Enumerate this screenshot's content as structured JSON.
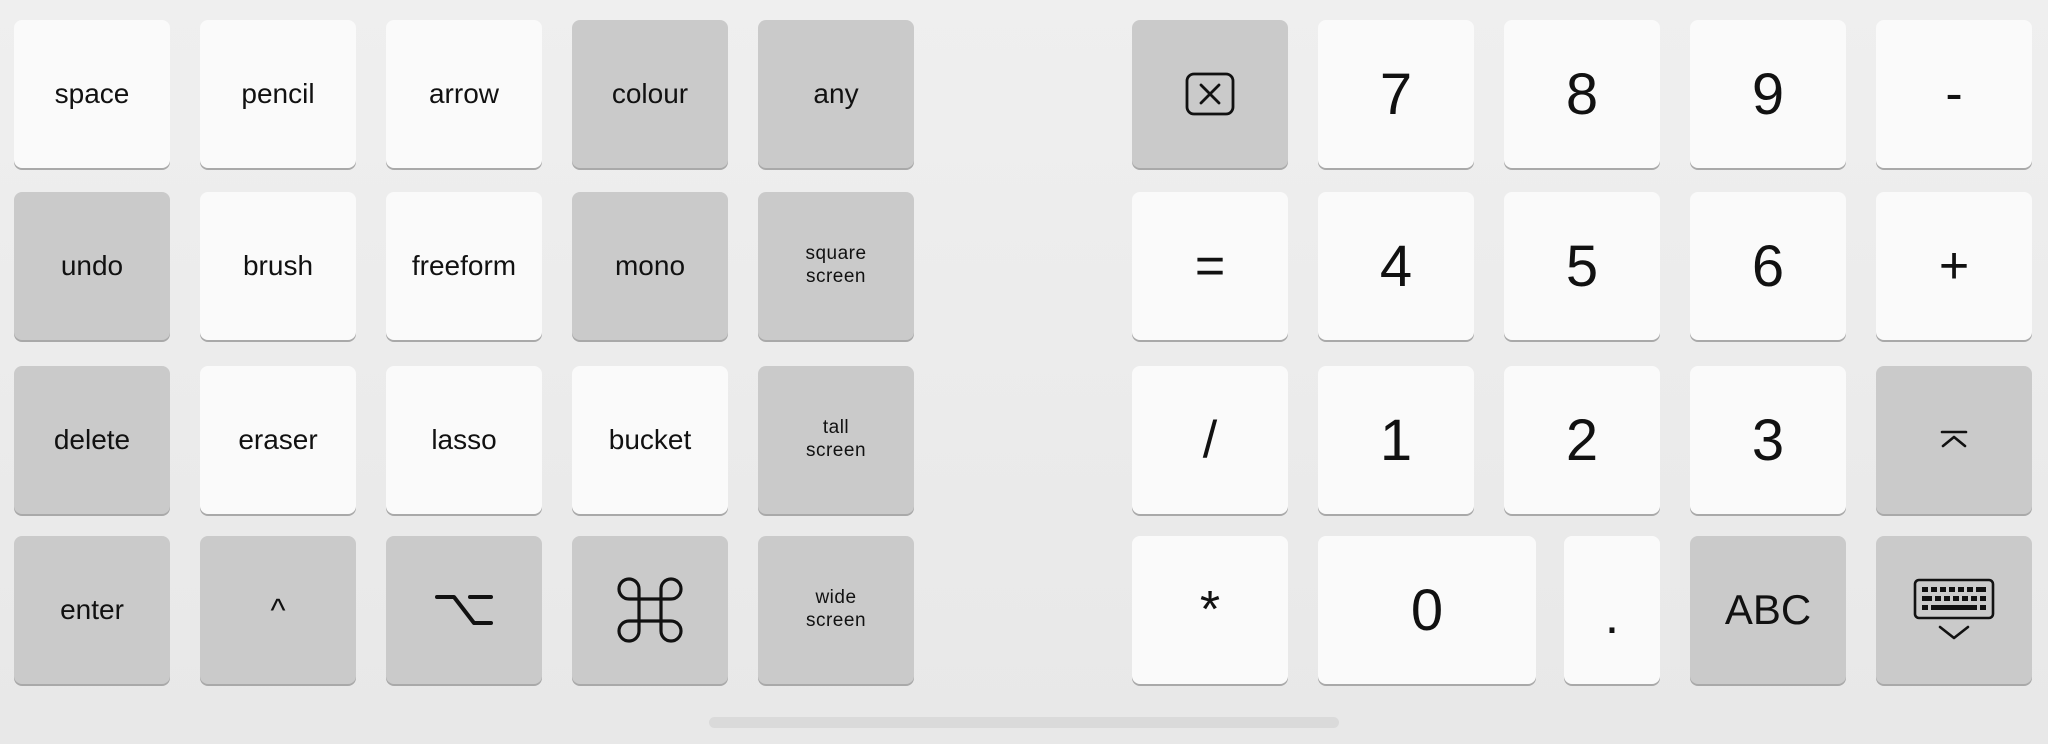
{
  "left_keys": {
    "space": "space",
    "pencil": "pencil",
    "arrow": "arrow",
    "colour": "colour",
    "any": "any",
    "undo": "undo",
    "brush": "brush",
    "freeform": "freeform",
    "mono": "mono",
    "square_screen": "square\nscreen",
    "delete": "delete",
    "eraser": "eraser",
    "lasso": "lasso",
    "bucket": "bucket",
    "tall_screen": "tall\nscreen",
    "enter": "enter",
    "control": "^",
    "option_icon": "option-icon",
    "command_icon": "command-icon",
    "wide_screen": "wide\nscreen"
  },
  "numpad": {
    "backspace_icon": "backspace-icon",
    "seven": "7",
    "eight": "8",
    "nine": "9",
    "minus": "-",
    "equals": "=",
    "four": "4",
    "five": "5",
    "six": "6",
    "plus": "+",
    "slash": "/",
    "one": "1",
    "two": "2",
    "three": "3",
    "collapse_icon": "collapse-up-icon",
    "asterisk": "*",
    "zero": "0",
    "dot": ".",
    "abc": "ABC",
    "keyboard_icon": "keyboard-dismiss-icon"
  },
  "colors": {
    "light_key": "#fafafa",
    "dark_key": "#cacaca",
    "background": "#ececec"
  }
}
